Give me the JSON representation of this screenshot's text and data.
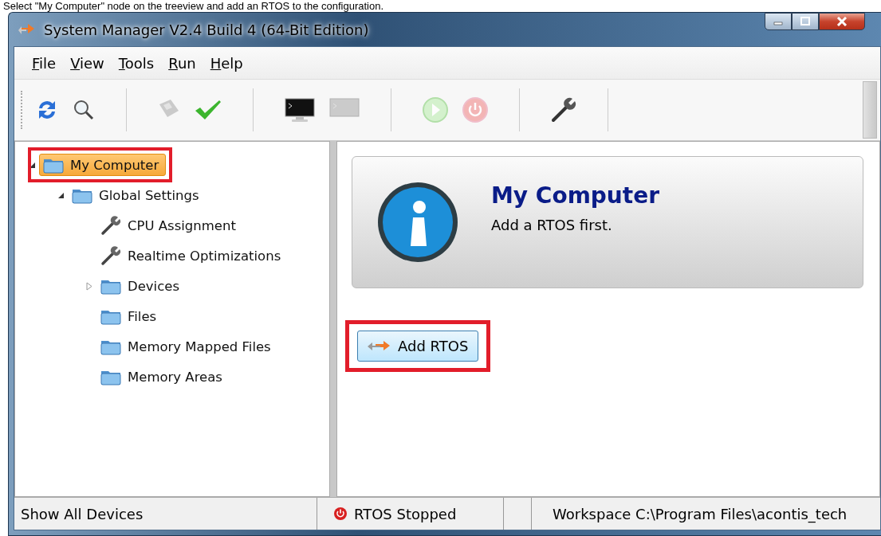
{
  "caption": "Select \"My Computer\" node on the treeview and add an RTOS to the configuration.",
  "window": {
    "title": "System Manager V2.4 Build 4 (64-Bit Edition)"
  },
  "menu": [
    "File",
    "View",
    "Tools",
    "Run",
    "Help"
  ],
  "toolbar": [
    {
      "kind": "refresh",
      "disabled": false
    },
    {
      "kind": "search",
      "disabled": false
    },
    {
      "kind": "sep"
    },
    {
      "kind": "save",
      "disabled": true
    },
    {
      "kind": "check",
      "disabled": false
    },
    {
      "kind": "sep"
    },
    {
      "kind": "console",
      "disabled": false
    },
    {
      "kind": "console",
      "disabled": true
    },
    {
      "kind": "sep"
    },
    {
      "kind": "play",
      "disabled": true
    },
    {
      "kind": "power",
      "disabled": true
    },
    {
      "kind": "sep"
    },
    {
      "kind": "wrench",
      "disabled": false
    },
    {
      "kind": "sep"
    }
  ],
  "tree": [
    {
      "label": "My Computer",
      "kind": "folder",
      "expanded": true,
      "selected": true,
      "highlighted": true,
      "children": [
        {
          "label": "Global Settings",
          "kind": "folder",
          "expanded": true,
          "selected": false,
          "highlighted": false,
          "children": [
            {
              "label": "CPU Assignment",
              "kind": "wrench",
              "selected": false,
              "highlighted": false
            },
            {
              "label": "Realtime Optimizations",
              "kind": "wrench",
              "selected": false,
              "highlighted": false
            },
            {
              "label": "Devices",
              "kind": "folder",
              "expanded": false,
              "selected": false,
              "highlighted": false
            },
            {
              "label": "Files",
              "kind": "folder",
              "selected": false,
              "highlighted": false
            },
            {
              "label": "Memory Mapped Files",
              "kind": "folder",
              "selected": false,
              "highlighted": false
            },
            {
              "label": "Memory Areas",
              "kind": "folder",
              "selected": false,
              "highlighted": false
            }
          ]
        }
      ]
    }
  ],
  "info": {
    "title": "My Computer",
    "message": "Add a RTOS first."
  },
  "action_button": {
    "label": "Add RTOS",
    "highlighted": true
  },
  "status_bar": [
    {
      "kind": "text",
      "text": "Show All Devices"
    },
    {
      "kind": "stopped",
      "text": "RTOS Stopped"
    },
    {
      "kind": "empty"
    },
    {
      "kind": "text",
      "text": "Workspace  C:\\Program Files\\acontis_tech"
    }
  ]
}
